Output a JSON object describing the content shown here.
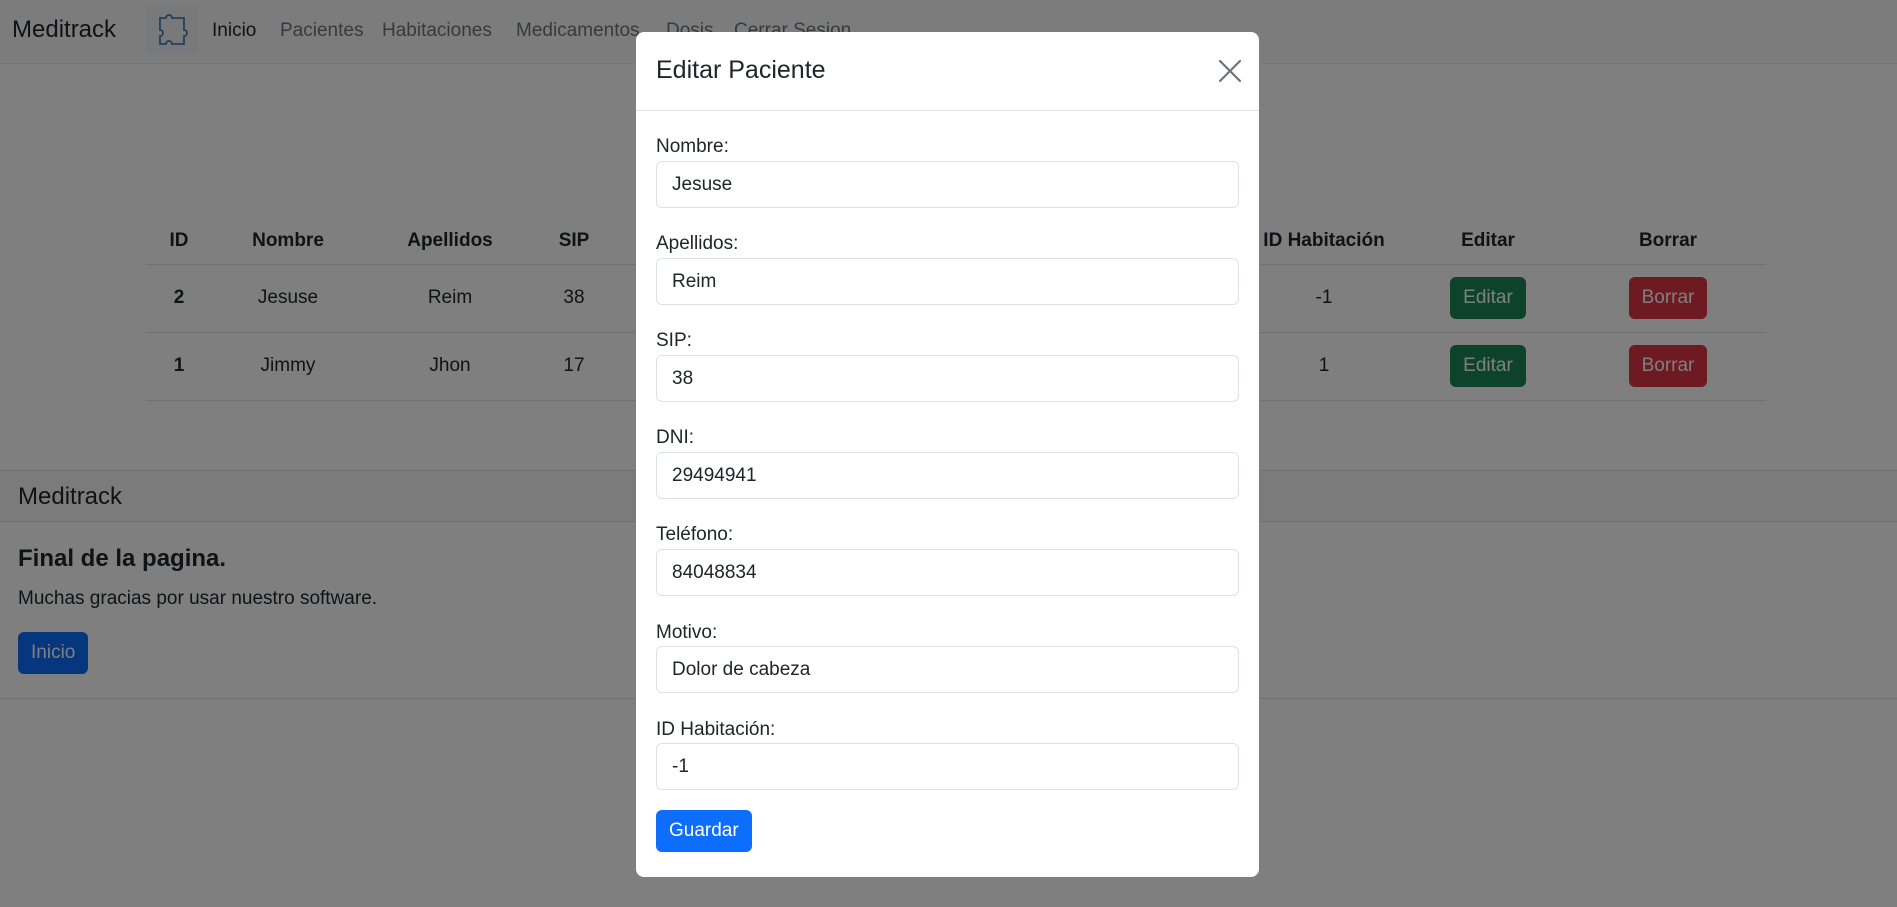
{
  "navbar": {
    "brand": "Meditrack",
    "links": [
      "Inicio",
      "Pacientes",
      "Habitaciones",
      "Medicamentos",
      "Dosis",
      "Cerrar Sesion"
    ]
  },
  "table": {
    "headers": [
      "ID",
      "Nombre",
      "Apellidos",
      "SIP",
      "ID Habitación",
      "Editar",
      "Borrar"
    ],
    "rows": [
      {
        "id": "2",
        "nombre": "Jesuse",
        "apellidos": "Reim",
        "sip": "38",
        "habitacion": "-1",
        "edit_label": "Editar",
        "delete_label": "Borrar"
      },
      {
        "id": "1",
        "nombre": "Jimmy",
        "apellidos": "Jhon",
        "sip": "17",
        "habitacion": "1",
        "edit_label": "Editar",
        "delete_label": "Borrar"
      }
    ]
  },
  "footer": {
    "header": "Meditrack",
    "title": "Final de la pagina.",
    "text": "Muchas gracias por usar nuestro software.",
    "button": "Inicio"
  },
  "modal": {
    "title": "Editar Paciente",
    "fields": [
      {
        "label": "Nombre:",
        "value": "Jesuse"
      },
      {
        "label": "Apellidos:",
        "value": "Reim"
      },
      {
        "label": "SIP:",
        "value": "38"
      },
      {
        "label": "DNI:",
        "value": "29494941"
      },
      {
        "label": "Teléfono:",
        "value": "84048834"
      },
      {
        "label": "Motivo:",
        "value": "Dolor de cabeza"
      },
      {
        "label": "ID Habitación:",
        "value": "-1"
      }
    ],
    "save_label": "Guardar"
  },
  "colors": {
    "primary": "#0d6efd",
    "success": "#198754",
    "danger": "#dc3545",
    "backdrop": "rgba(0,0,0,0.5)"
  },
  "icons": {
    "logo": "puzzle-logo-icon",
    "close": "close-icon"
  }
}
